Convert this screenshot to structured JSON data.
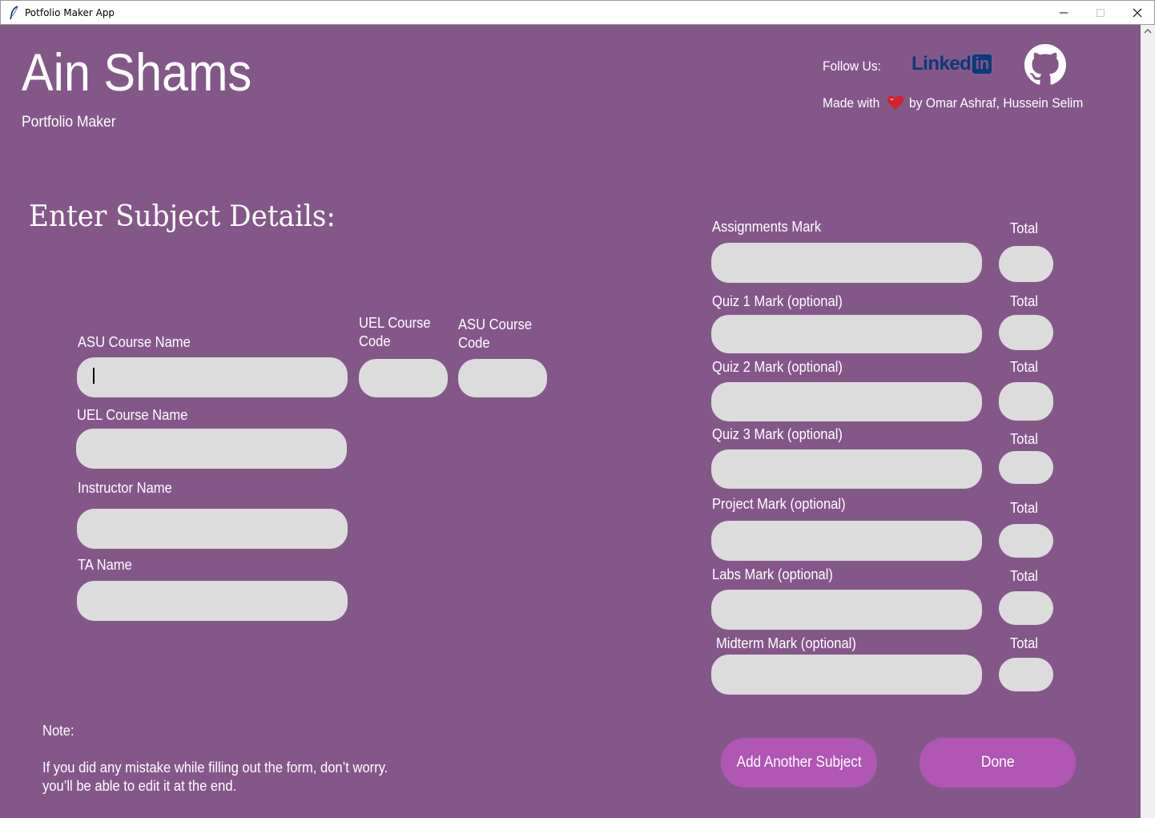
{
  "window": {
    "title": "Potfolio Maker App"
  },
  "header": {
    "title": "Ain Shams",
    "subtitle": "Portfolio Maker",
    "follow_label": "Follow Us:",
    "linkedin_text": "Linked",
    "linkedin_in": "in",
    "made_with_prefix": "Made with",
    "made_with_suffix": "by Omar Ashraf, Hussein Selim"
  },
  "form": {
    "heading": "Enter Subject Details:",
    "asu_course_name": "ASU Course Name",
    "uel_course_code": [
      "UEL Course",
      "Code"
    ],
    "asu_course_code": [
      "ASU Course",
      "Code"
    ],
    "uel_course_name": "UEL Course Name",
    "instructor_name": "Instructor Name",
    "ta_name": "TA Name"
  },
  "marks": {
    "total_label": "Total",
    "rows": [
      "Assignments Mark",
      "Quiz 1 Mark (optional)",
      "Quiz 2 Mark (optional)",
      "Quiz 3 Mark (optional)",
      "Project Mark (optional)",
      "Labs Mark (optional)",
      "Midterm Mark (optional)"
    ]
  },
  "note": {
    "title": "Note:",
    "line1": "If you did any mistake while filling out the form, don’t worry.",
    "line2": "you’ll be able to edit it at the end."
  },
  "buttons": {
    "add_subject": "Add Another Subject",
    "done": "Done"
  },
  "colors": {
    "background": "#835889",
    "button": "#b056b4",
    "input": "#dcdcdc",
    "linkedin": "#0a3a7a"
  }
}
